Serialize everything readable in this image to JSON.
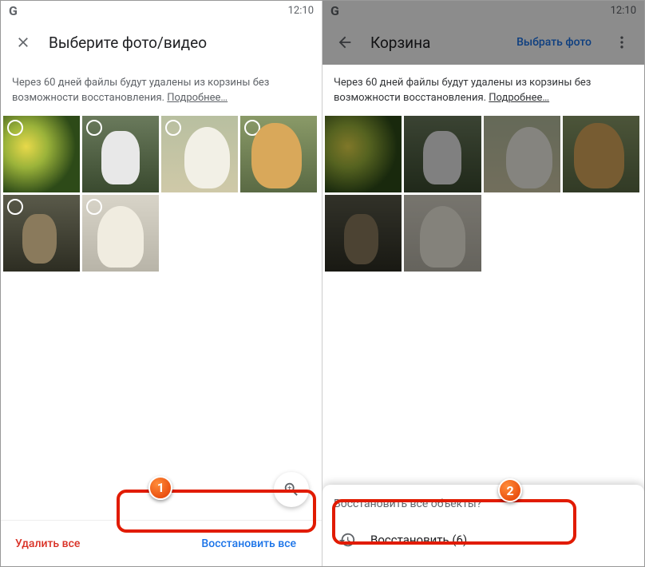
{
  "statusbar": {
    "logo": "G",
    "time": "12:10"
  },
  "screen1": {
    "title": "Выберите фото/видео",
    "notice": "Через 60 дней файлы будут удалены из корзины без возможности восстановления.",
    "learn_more": "Подробнее…",
    "delete_all": "Удалить все",
    "restore_all": "Восстановить все"
  },
  "screen2": {
    "title": "Корзина",
    "select_link": "Выбрать фото",
    "notice": "Через 60 дней файлы будут удалены из корзины без возможности восстановления.",
    "learn_more": "Подробнее…",
    "sheet_title": "Восстановить все объекты?",
    "sheet_action": "Восстановить (6)"
  },
  "steps": {
    "one": "1",
    "two": "2"
  },
  "colors": {
    "accent": "#1a73e8",
    "danger": "#d93025",
    "callout": "#e11b00"
  }
}
